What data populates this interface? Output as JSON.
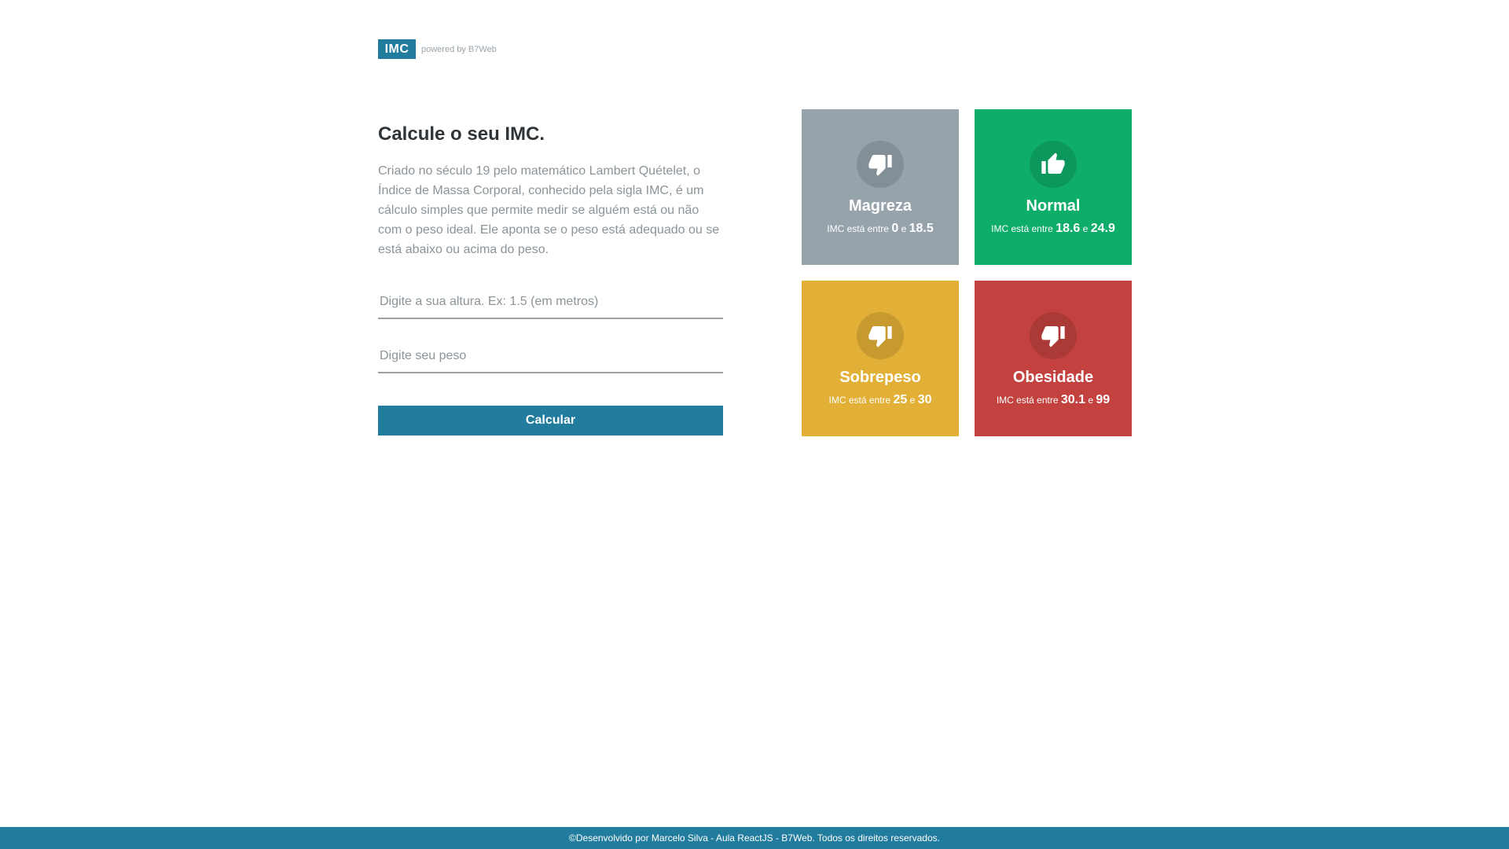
{
  "header": {
    "logo_text": "IMC",
    "powered_by": "powered by B7Web",
    "brand_color": "#227c9d"
  },
  "intro": {
    "title": "Calcule o seu IMC.",
    "description": "Criado no século 19 pelo matemático Lambert Quételet, o Índice de Massa Corporal, conhecido pela sigla IMC, é um cálculo simples que permite medir se alguém está ou não com o peso ideal. Ele aponta se o peso está adequado ou se está abaixo ou acima do peso."
  },
  "form": {
    "height_placeholder": "Digite a sua altura. Ex: 1.5 (em metros)",
    "height_value": "",
    "weight_placeholder": "Digite seu peso",
    "weight_value": "",
    "submit_label": "Calcular"
  },
  "levels": [
    {
      "title": "Magreza",
      "range_prefix": "IMC está entre",
      "min": "0",
      "joiner": "e",
      "max": "18.5",
      "color": "#96a3ab",
      "icon": "thumbs-down-icon"
    },
    {
      "title": "Normal",
      "range_prefix": "IMC está entre",
      "min": "18.6",
      "joiner": "e",
      "max": "24.9",
      "color": "#0ead69",
      "icon": "thumbs-up-icon"
    },
    {
      "title": "Sobrepeso",
      "range_prefix": "IMC está entre",
      "min": "25",
      "joiner": "e",
      "max": "30",
      "color": "#e2b036",
      "icon": "thumbs-down-icon"
    },
    {
      "title": "Obesidade",
      "range_prefix": "IMC está entre",
      "min": "30.1",
      "joiner": "e",
      "max": "99",
      "color": "#c3423f",
      "icon": "thumbs-down-icon"
    }
  ],
  "footer": {
    "text": "©Desenvolvido por Marcelo Silva - Aula ReactJS - B7Web. Todos os direitos reservados."
  }
}
